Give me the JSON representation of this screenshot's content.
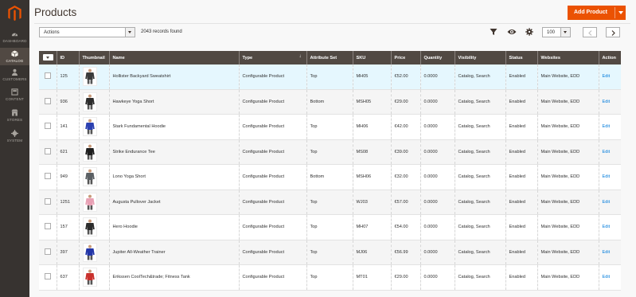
{
  "nav": {
    "dashboard": "DASHBOARD",
    "catalog": "CATALOG",
    "customers": "CUSTOMERS",
    "content": "CONTENT",
    "stores": "STORES",
    "system": "SYSTEM"
  },
  "page": {
    "title": "Products",
    "add_label": "Add Product"
  },
  "toolbar": {
    "actions_value": "Actions",
    "records": "2043 records found",
    "per_page": "100"
  },
  "columns": {
    "id": "ID",
    "thumbnail": "Thumbnail",
    "name": "Name",
    "type": "Type",
    "attribute_set": "Attribute Set",
    "sku": "SKU",
    "price": "Price",
    "quantity": "Quantity",
    "visibility": "Visibility",
    "status": "Status",
    "websites": "Websites",
    "action": "Action"
  },
  "colors": {
    "accent": "#eb5202",
    "header": "#514943",
    "sidebar": "#373330",
    "link": "#007bdb"
  },
  "rows": [
    {
      "id": "125",
      "name": "Hollister Backyard Sweatshirt",
      "type": "Configurable Product",
      "attribute_set": "Top",
      "sku": "MH05",
      "price": "€52.00",
      "quantity": "0.0000",
      "visibility": "Catalog, Search",
      "status": "Enabled",
      "websites": "Main Website, EDD",
      "action": "Edit",
      "thumb_color": "#3a3a3a"
    },
    {
      "id": "936",
      "name": "Hawkeye Yoga Short",
      "type": "Configurable Product",
      "attribute_set": "Bottom",
      "sku": "MSH05",
      "price": "€29.00",
      "quantity": "0.0000",
      "visibility": "Catalog, Search",
      "status": "Enabled",
      "websites": "Main Website, EDD",
      "action": "Edit",
      "thumb_color": "#2c2c2c"
    },
    {
      "id": "141",
      "name": "Stark Fundamental Hoodie",
      "type": "Configurable Product",
      "attribute_set": "Top",
      "sku": "MH06",
      "price": "€42.00",
      "quantity": "0.0000",
      "visibility": "Catalog, Search",
      "status": "Enabled",
      "websites": "Main Website, EDD",
      "action": "Edit",
      "thumb_color": "#2a3fb0"
    },
    {
      "id": "621",
      "name": "Strike Endurance Tee",
      "type": "Configurable Product",
      "attribute_set": "Top",
      "sku": "MS08",
      "price": "€39.00",
      "quantity": "0.0000",
      "visibility": "Catalog, Search",
      "status": "Enabled",
      "websites": "Main Website, EDD",
      "action": "Edit",
      "thumb_color": "#1e1e1e"
    },
    {
      "id": "949",
      "name": "Lono Yoga Short",
      "type": "Configurable Product",
      "attribute_set": "Bottom",
      "sku": "MSH06",
      "price": "€32.00",
      "quantity": "0.0000",
      "visibility": "Catalog, Search",
      "status": "Enabled",
      "websites": "Main Website, EDD",
      "action": "Edit",
      "thumb_color": "#5a5f63"
    },
    {
      "id": "1251",
      "name": "Augusta Pullover Jacket",
      "type": "Configurable Product",
      "attribute_set": "Top",
      "sku": "WJ03",
      "price": "€57.00",
      "quantity": "0.0000",
      "visibility": "Catalog, Search",
      "status": "Enabled",
      "websites": "Main Website, EDD",
      "action": "Edit",
      "thumb_color": "#e8a0b4"
    },
    {
      "id": "157",
      "name": "Hero Hoodie",
      "type": "Configurable Product",
      "attribute_set": "Top",
      "sku": "MH07",
      "price": "€54.00",
      "quantity": "0.0000",
      "visibility": "Catalog, Search",
      "status": "Enabled",
      "websites": "Main Website, EDD",
      "action": "Edit",
      "thumb_color": "#2b2b2b"
    },
    {
      "id": "397",
      "name": "Jupiter All-Weather Trainer",
      "type": "Configurable Product",
      "attribute_set": "Top",
      "sku": "MJ06",
      "price": "€56.99",
      "quantity": "0.0000",
      "visibility": "Catalog, Search",
      "status": "Enabled",
      "websites": "Main Website, EDD",
      "action": "Edit",
      "thumb_color": "#2336a8"
    },
    {
      "id": "637",
      "name": "Erikssen CoolTech&trade; Fitness Tank",
      "type": "Configurable Product",
      "attribute_set": "Top",
      "sku": "MT01",
      "price": "€29.00",
      "quantity": "0.0000",
      "visibility": "Catalog, Search",
      "status": "Enabled",
      "websites": "Main Website, EDD",
      "action": "Edit",
      "thumb_color": "#c9302c"
    }
  ]
}
